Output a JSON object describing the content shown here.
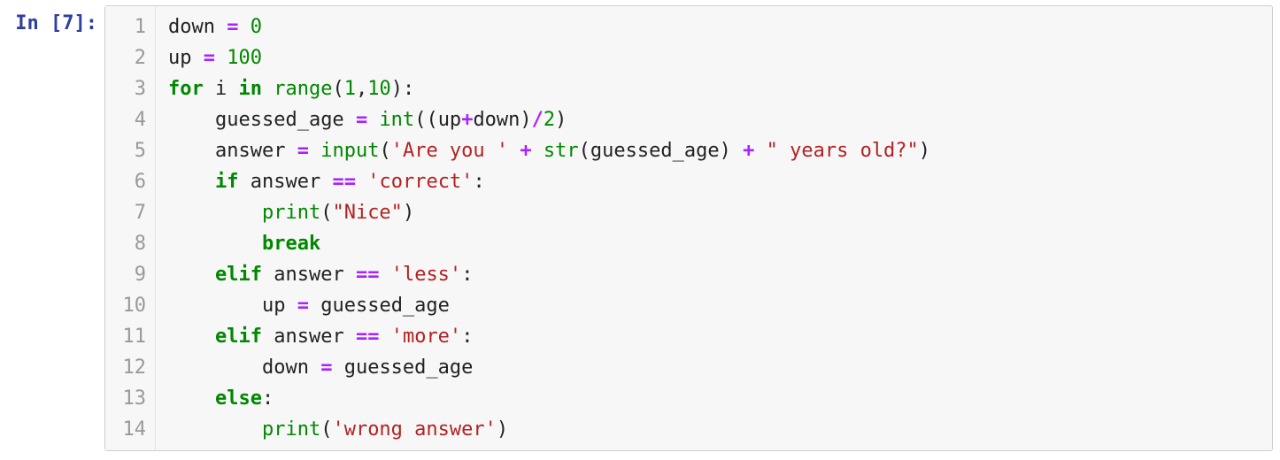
{
  "cell": {
    "prompt_prefix": "In ",
    "prompt_open": "[",
    "execution_count": "7",
    "prompt_close": "]:",
    "line_numbers": [
      "1",
      "2",
      "3",
      "4",
      "5",
      "6",
      "7",
      "8",
      "9",
      "10",
      "11",
      "12",
      "13",
      "14"
    ],
    "lines": [
      {
        "indent": "",
        "tokens": [
          {
            "t": "down",
            "c": "var"
          },
          {
            "t": " ",
            "c": "sp"
          },
          {
            "t": "=",
            "c": "op"
          },
          {
            "t": " ",
            "c": "sp"
          },
          {
            "t": "0",
            "c": "num"
          }
        ]
      },
      {
        "indent": "",
        "tokens": [
          {
            "t": "up",
            "c": "var"
          },
          {
            "t": " ",
            "c": "sp"
          },
          {
            "t": "=",
            "c": "op"
          },
          {
            "t": " ",
            "c": "sp"
          },
          {
            "t": "100",
            "c": "num"
          }
        ]
      },
      {
        "indent": "",
        "tokens": [
          {
            "t": "for",
            "c": "kw"
          },
          {
            "t": " ",
            "c": "sp"
          },
          {
            "t": "i",
            "c": "var"
          },
          {
            "t": " ",
            "c": "sp"
          },
          {
            "t": "in",
            "c": "kw"
          },
          {
            "t": " ",
            "c": "sp"
          },
          {
            "t": "range",
            "c": "bi"
          },
          {
            "t": "(",
            "c": "punc"
          },
          {
            "t": "1",
            "c": "num"
          },
          {
            "t": ",",
            "c": "punc"
          },
          {
            "t": "10",
            "c": "num"
          },
          {
            "t": ")",
            "c": "punc"
          },
          {
            "t": ":",
            "c": "punc"
          }
        ]
      },
      {
        "indent": "    ",
        "tokens": [
          {
            "t": "guessed_age",
            "c": "var"
          },
          {
            "t": " ",
            "c": "sp"
          },
          {
            "t": "=",
            "c": "op"
          },
          {
            "t": " ",
            "c": "sp"
          },
          {
            "t": "int",
            "c": "bi"
          },
          {
            "t": "(",
            "c": "punc"
          },
          {
            "t": "(",
            "c": "punc"
          },
          {
            "t": "up",
            "c": "var"
          },
          {
            "t": "+",
            "c": "op"
          },
          {
            "t": "down",
            "c": "var"
          },
          {
            "t": ")",
            "c": "punc"
          },
          {
            "t": "/",
            "c": "op"
          },
          {
            "t": "2",
            "c": "num"
          },
          {
            "t": ")",
            "c": "punc"
          }
        ]
      },
      {
        "indent": "    ",
        "tokens": [
          {
            "t": "answer",
            "c": "var"
          },
          {
            "t": " ",
            "c": "sp"
          },
          {
            "t": "=",
            "c": "op"
          },
          {
            "t": " ",
            "c": "sp"
          },
          {
            "t": "input",
            "c": "bi"
          },
          {
            "t": "(",
            "c": "punc"
          },
          {
            "t": "'Are you '",
            "c": "str"
          },
          {
            "t": " ",
            "c": "sp"
          },
          {
            "t": "+",
            "c": "op"
          },
          {
            "t": " ",
            "c": "sp"
          },
          {
            "t": "str",
            "c": "bi"
          },
          {
            "t": "(",
            "c": "punc"
          },
          {
            "t": "guessed_age",
            "c": "var"
          },
          {
            "t": ")",
            "c": "punc"
          },
          {
            "t": " ",
            "c": "sp"
          },
          {
            "t": "+",
            "c": "op"
          },
          {
            "t": " ",
            "c": "sp"
          },
          {
            "t": "\" years old?\"",
            "c": "str"
          },
          {
            "t": ")",
            "c": "punc"
          }
        ]
      },
      {
        "indent": "    ",
        "tokens": [
          {
            "t": "if",
            "c": "kw"
          },
          {
            "t": " ",
            "c": "sp"
          },
          {
            "t": "answer",
            "c": "var"
          },
          {
            "t": " ",
            "c": "sp"
          },
          {
            "t": "==",
            "c": "op"
          },
          {
            "t": " ",
            "c": "sp"
          },
          {
            "t": "'correct'",
            "c": "str"
          },
          {
            "t": ":",
            "c": "punc"
          }
        ]
      },
      {
        "indent": "        ",
        "tokens": [
          {
            "t": "print",
            "c": "bi"
          },
          {
            "t": "(",
            "c": "punc"
          },
          {
            "t": "\"Nice\"",
            "c": "str"
          },
          {
            "t": ")",
            "c": "punc"
          }
        ]
      },
      {
        "indent": "        ",
        "tokens": [
          {
            "t": "break",
            "c": "kw"
          }
        ]
      },
      {
        "indent": "    ",
        "tokens": [
          {
            "t": "elif",
            "c": "kw"
          },
          {
            "t": " ",
            "c": "sp"
          },
          {
            "t": "answer",
            "c": "var"
          },
          {
            "t": " ",
            "c": "sp"
          },
          {
            "t": "==",
            "c": "op"
          },
          {
            "t": " ",
            "c": "sp"
          },
          {
            "t": "'less'",
            "c": "str"
          },
          {
            "t": ":",
            "c": "punc"
          }
        ]
      },
      {
        "indent": "        ",
        "tokens": [
          {
            "t": "up",
            "c": "var"
          },
          {
            "t": " ",
            "c": "sp"
          },
          {
            "t": "=",
            "c": "op"
          },
          {
            "t": " ",
            "c": "sp"
          },
          {
            "t": "guessed_age",
            "c": "var"
          }
        ]
      },
      {
        "indent": "    ",
        "tokens": [
          {
            "t": "elif",
            "c": "kw"
          },
          {
            "t": " ",
            "c": "sp"
          },
          {
            "t": "answer",
            "c": "var"
          },
          {
            "t": " ",
            "c": "sp"
          },
          {
            "t": "==",
            "c": "op"
          },
          {
            "t": " ",
            "c": "sp"
          },
          {
            "t": "'more'",
            "c": "str"
          },
          {
            "t": ":",
            "c": "punc"
          }
        ]
      },
      {
        "indent": "        ",
        "tokens": [
          {
            "t": "down",
            "c": "var"
          },
          {
            "t": " ",
            "c": "sp"
          },
          {
            "t": "=",
            "c": "op"
          },
          {
            "t": " ",
            "c": "sp"
          },
          {
            "t": "guessed_age",
            "c": "var"
          }
        ]
      },
      {
        "indent": "    ",
        "tokens": [
          {
            "t": "else",
            "c": "kw"
          },
          {
            "t": ":",
            "c": "punc"
          }
        ]
      },
      {
        "indent": "        ",
        "tokens": [
          {
            "t": "print",
            "c": "bi"
          },
          {
            "t": "(",
            "c": "punc"
          },
          {
            "t": "'wrong answer'",
            "c": "str"
          },
          {
            "t": ")",
            "c": "punc"
          }
        ]
      }
    ]
  }
}
